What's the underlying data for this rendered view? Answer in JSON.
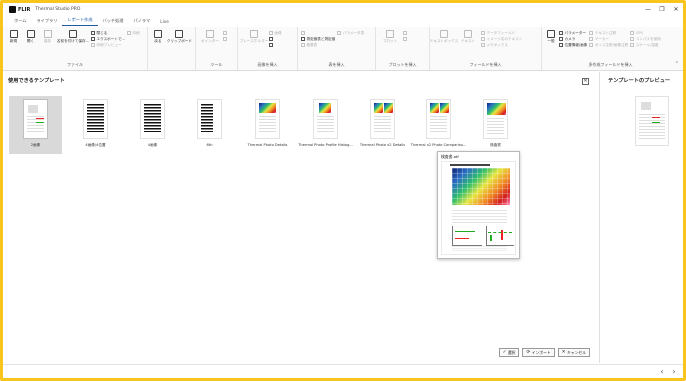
{
  "app": {
    "brand": "FLIR",
    "title": "Thermal Studio PRO",
    "window_controls": [
      "—",
      "❐",
      "✕"
    ]
  },
  "menu_tabs": [
    {
      "label": "ホーム",
      "active": false
    },
    {
      "label": "ライブラリ",
      "active": false
    },
    {
      "label": "レポート作成",
      "active": true
    },
    {
      "label": "バッチ処理",
      "active": false
    },
    {
      "label": "パノラマ",
      "active": false
    },
    {
      "label": "Live",
      "active": false
    }
  ],
  "ribbon": {
    "groups": [
      {
        "label": "ファイル"
      },
      {
        "label": ""
      },
      {
        "label": "ツール"
      },
      {
        "label": "画像を挿入"
      },
      {
        "label": "表を挿入"
      },
      {
        "label": "プロットを挿入"
      },
      {
        "label": "フィールドを挿入"
      },
      {
        "label": "多作成フィールドを挿入"
      }
    ],
    "file": {
      "new": "新規",
      "open": "開く",
      "save": "保存",
      "save_as": "名前を付けて保存...",
      "close": "閉じる",
      "export": "エクスポートで...",
      "print": "印刷",
      "page_setup": "印刷プレビュー"
    },
    "misc": {
      "revert": "戻る",
      "clipboard": "クリップボード"
    },
    "tools": {
      "pointer": "ポインター",
      "text": "テキスト",
      "shape": "図形"
    },
    "images": {
      "placeholder": "プレースホルダー",
      "img": "画像",
      "digital": "デジタル写真"
    },
    "tables": {
      "measurement": "測定値表と測定値",
      "parameters": "パラメータ表",
      "summary": "概要表"
    },
    "plots": {
      "plot": "プロット",
      "profile": "プロファイル",
      "histogram": "ヒストグラム"
    },
    "fields": {
      "text_box": "テキストボックス",
      "text_field": "テキスト",
      "date_field": "データフィールド",
      "image_name": "イメージ名のテキスト",
      "note": "メモボックス"
    },
    "multi": {
      "all": "一般",
      "parameters": "パラメーター",
      "camera": "カメラ",
      "location": "位置情報/画像",
      "text": "テキスト注釈",
      "marker": "マーカー",
      "voice": "ボイス注釈/画像注釈",
      "gps": "GPS",
      "compass": "コンパスを使用",
      "scale": "スケール/温度"
    }
  },
  "templates_pane": {
    "title": "使用できるテンプレート",
    "close_glyph": "✕",
    "items": [
      {
        "caption": "2画像",
        "style": "chart",
        "selected": true
      },
      {
        "caption": "4画像/4位置",
        "style": "bars",
        "selected": false
      },
      {
        "caption": "4画像",
        "style": "bars",
        "selected": false
      },
      {
        "caption": "6th",
        "style": "bars",
        "selected": false
      },
      {
        "caption": "Thermal Photo Details",
        "style": "heat",
        "selected": false
      },
      {
        "caption": "Thermal Photo Profile Histog...",
        "style": "heat",
        "selected": false
      },
      {
        "caption": "Thermal Photo x2 Details",
        "style": "heat",
        "selected": false
      },
      {
        "caption": "Thermal x2 Photo Compariso...",
        "style": "heat",
        "selected": false
      },
      {
        "caption": "検査書",
        "style": "heat",
        "selected": false
      }
    ],
    "tooltip": {
      "title": "検査書.atf"
    }
  },
  "buttons": {
    "select": {
      "icon": "✓",
      "label": "選択"
    },
    "import": {
      "icon": "⟳",
      "label": "インポート"
    },
    "cancel": {
      "icon": "✕",
      "label": "キャンセル"
    }
  },
  "preview_pane": {
    "title": "テンプレートのプレビュー"
  },
  "status": {
    "prev": "‹",
    "next": "›"
  },
  "colors": {
    "frame": "#f7c51e",
    "accent": "#1e5aa8",
    "selected_tile": "#d9d9d9"
  }
}
